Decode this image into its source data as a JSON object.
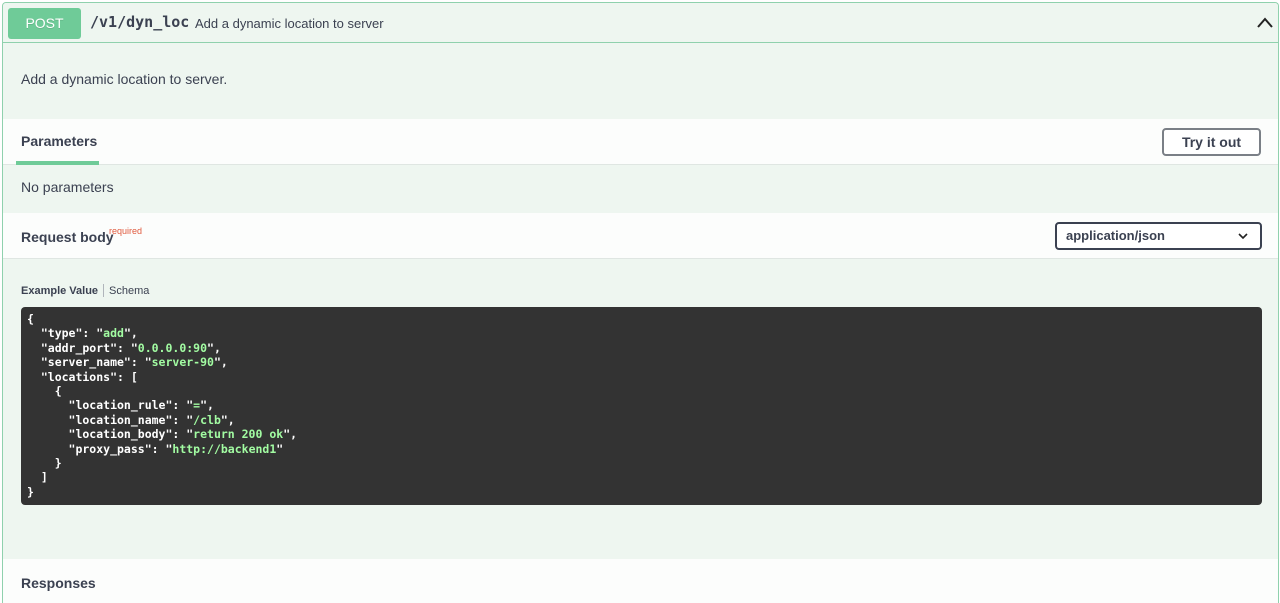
{
  "summary": {
    "method": "POST",
    "path": "/v1/dyn_loc",
    "description": "Add a dynamic location to server"
  },
  "description": "Add a dynamic location to server.",
  "parameters": {
    "tab_label": "Parameters",
    "try_label": "Try it out",
    "empty_text": "No parameters"
  },
  "request_body": {
    "title": "Request body",
    "required_label": "required",
    "content_type": "application/json",
    "tabs": {
      "example": "Example Value",
      "schema": "Schema"
    },
    "example": {
      "type": "add",
      "addr_port": "0.0.0.0:90",
      "server_name": "server-90",
      "location_rule": "=",
      "location_name": "/clb",
      "location_body": "return 200 ok",
      "proxy_pass": "http://backend1"
    }
  },
  "responses": {
    "title": "Responses"
  },
  "colors": {
    "post": "#6fcb98",
    "border": "#8fd1ad",
    "code_bg": "#333333",
    "string": "#a2fca2"
  },
  "icons": {
    "collapse": "chevron-up-icon",
    "select": "chevron-down-icon"
  }
}
